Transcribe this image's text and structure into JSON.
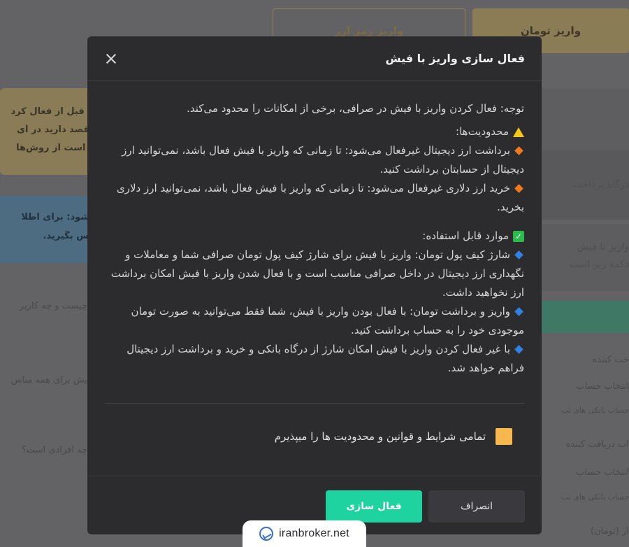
{
  "background": {
    "tab_crypto": "واریز رمز ارز",
    "tab_toman": "واریز تومان",
    "warn_lines": [
      "م: قبل از فعال کرد",
      "ر قصد دارید در آی",
      "ئر است از روش‌ها"
    ],
    "info_lines": [
      "ی‌شود: برای اطلا",
      "ماس بگیرید."
    ],
    "gateway": "درگاه پرداخت",
    "receipt_lines": [
      "واریز با فیش",
      "دکمه زیر است"
    ],
    "q1": "چیست و چه کاربر",
    "q2": "یش برای همه مناس",
    "q3": "چه افرادی است؟",
    "payer_label": "خت کننده",
    "select_account": "انتخاب حساب",
    "bank_accounts": "حساب بانکی های ثب",
    "receiver_label": "اب دریافت کننده",
    "select_account2": "انتخاب حساب",
    "bank_accounts2": "حساب بانکی های ثب",
    "amount_label": "ار (تومان)"
  },
  "modal": {
    "title": "فعال سازی واریز با فیش",
    "note": "توجه: فعال کردن واریز با فیش در صرافی، برخی از امکانات را محدود می‌کند.",
    "limits_title": "محدودیت‌ها:",
    "limits": [
      "برداشت ارز دیجیتال غیرفعال می‌شود: تا زمانی که واریز با فیش فعال باشد، نمی‌توانید ارز دیجیتال از حسابتان برداشت کنید.",
      "خرید ارز دلاری غیرفعال می‌شود: تا زمانی که واریز با فیش فعال باشد، نمی‌توانید ارز دلاری بخرید."
    ],
    "usable_title": "موارد قابل استفاده:",
    "usable": [
      "شارژ کیف پول تومان: واریز با فیش برای شارژ کیف پول تومان صرافی شما و معاملات و نگهداری ارز دیجیتال در داخل صرافی مناسب است و با فعال شدن واریز با فیش امکان برداشت ارز نخواهید داشت.",
      "واریز و برداشت تومان: با فعال بودن واریز با فیش، شما فقط می‌توانید به صورت تومان موجودی خود را به حساب برداشت کنید.",
      "با غیر فعال کردن واریز با فیش امکان شارژ از درگاه بانکی و خرید و برداشت ارز دیجیتال فراهم خواهد شد."
    ],
    "terms": "تمامی شرایط و قوانین و محدودیت ها را میپذیرم",
    "activate_label": "فعال سازی",
    "cancel_label": "انصراف",
    "colors": {
      "accent": "#1ed3a0",
      "checkbox": "#f7b84e",
      "limit_bullet": "#f07a1a",
      "usable_bullet": "#2f82e0"
    }
  },
  "watermark": {
    "text": "iranbroker.net"
  }
}
